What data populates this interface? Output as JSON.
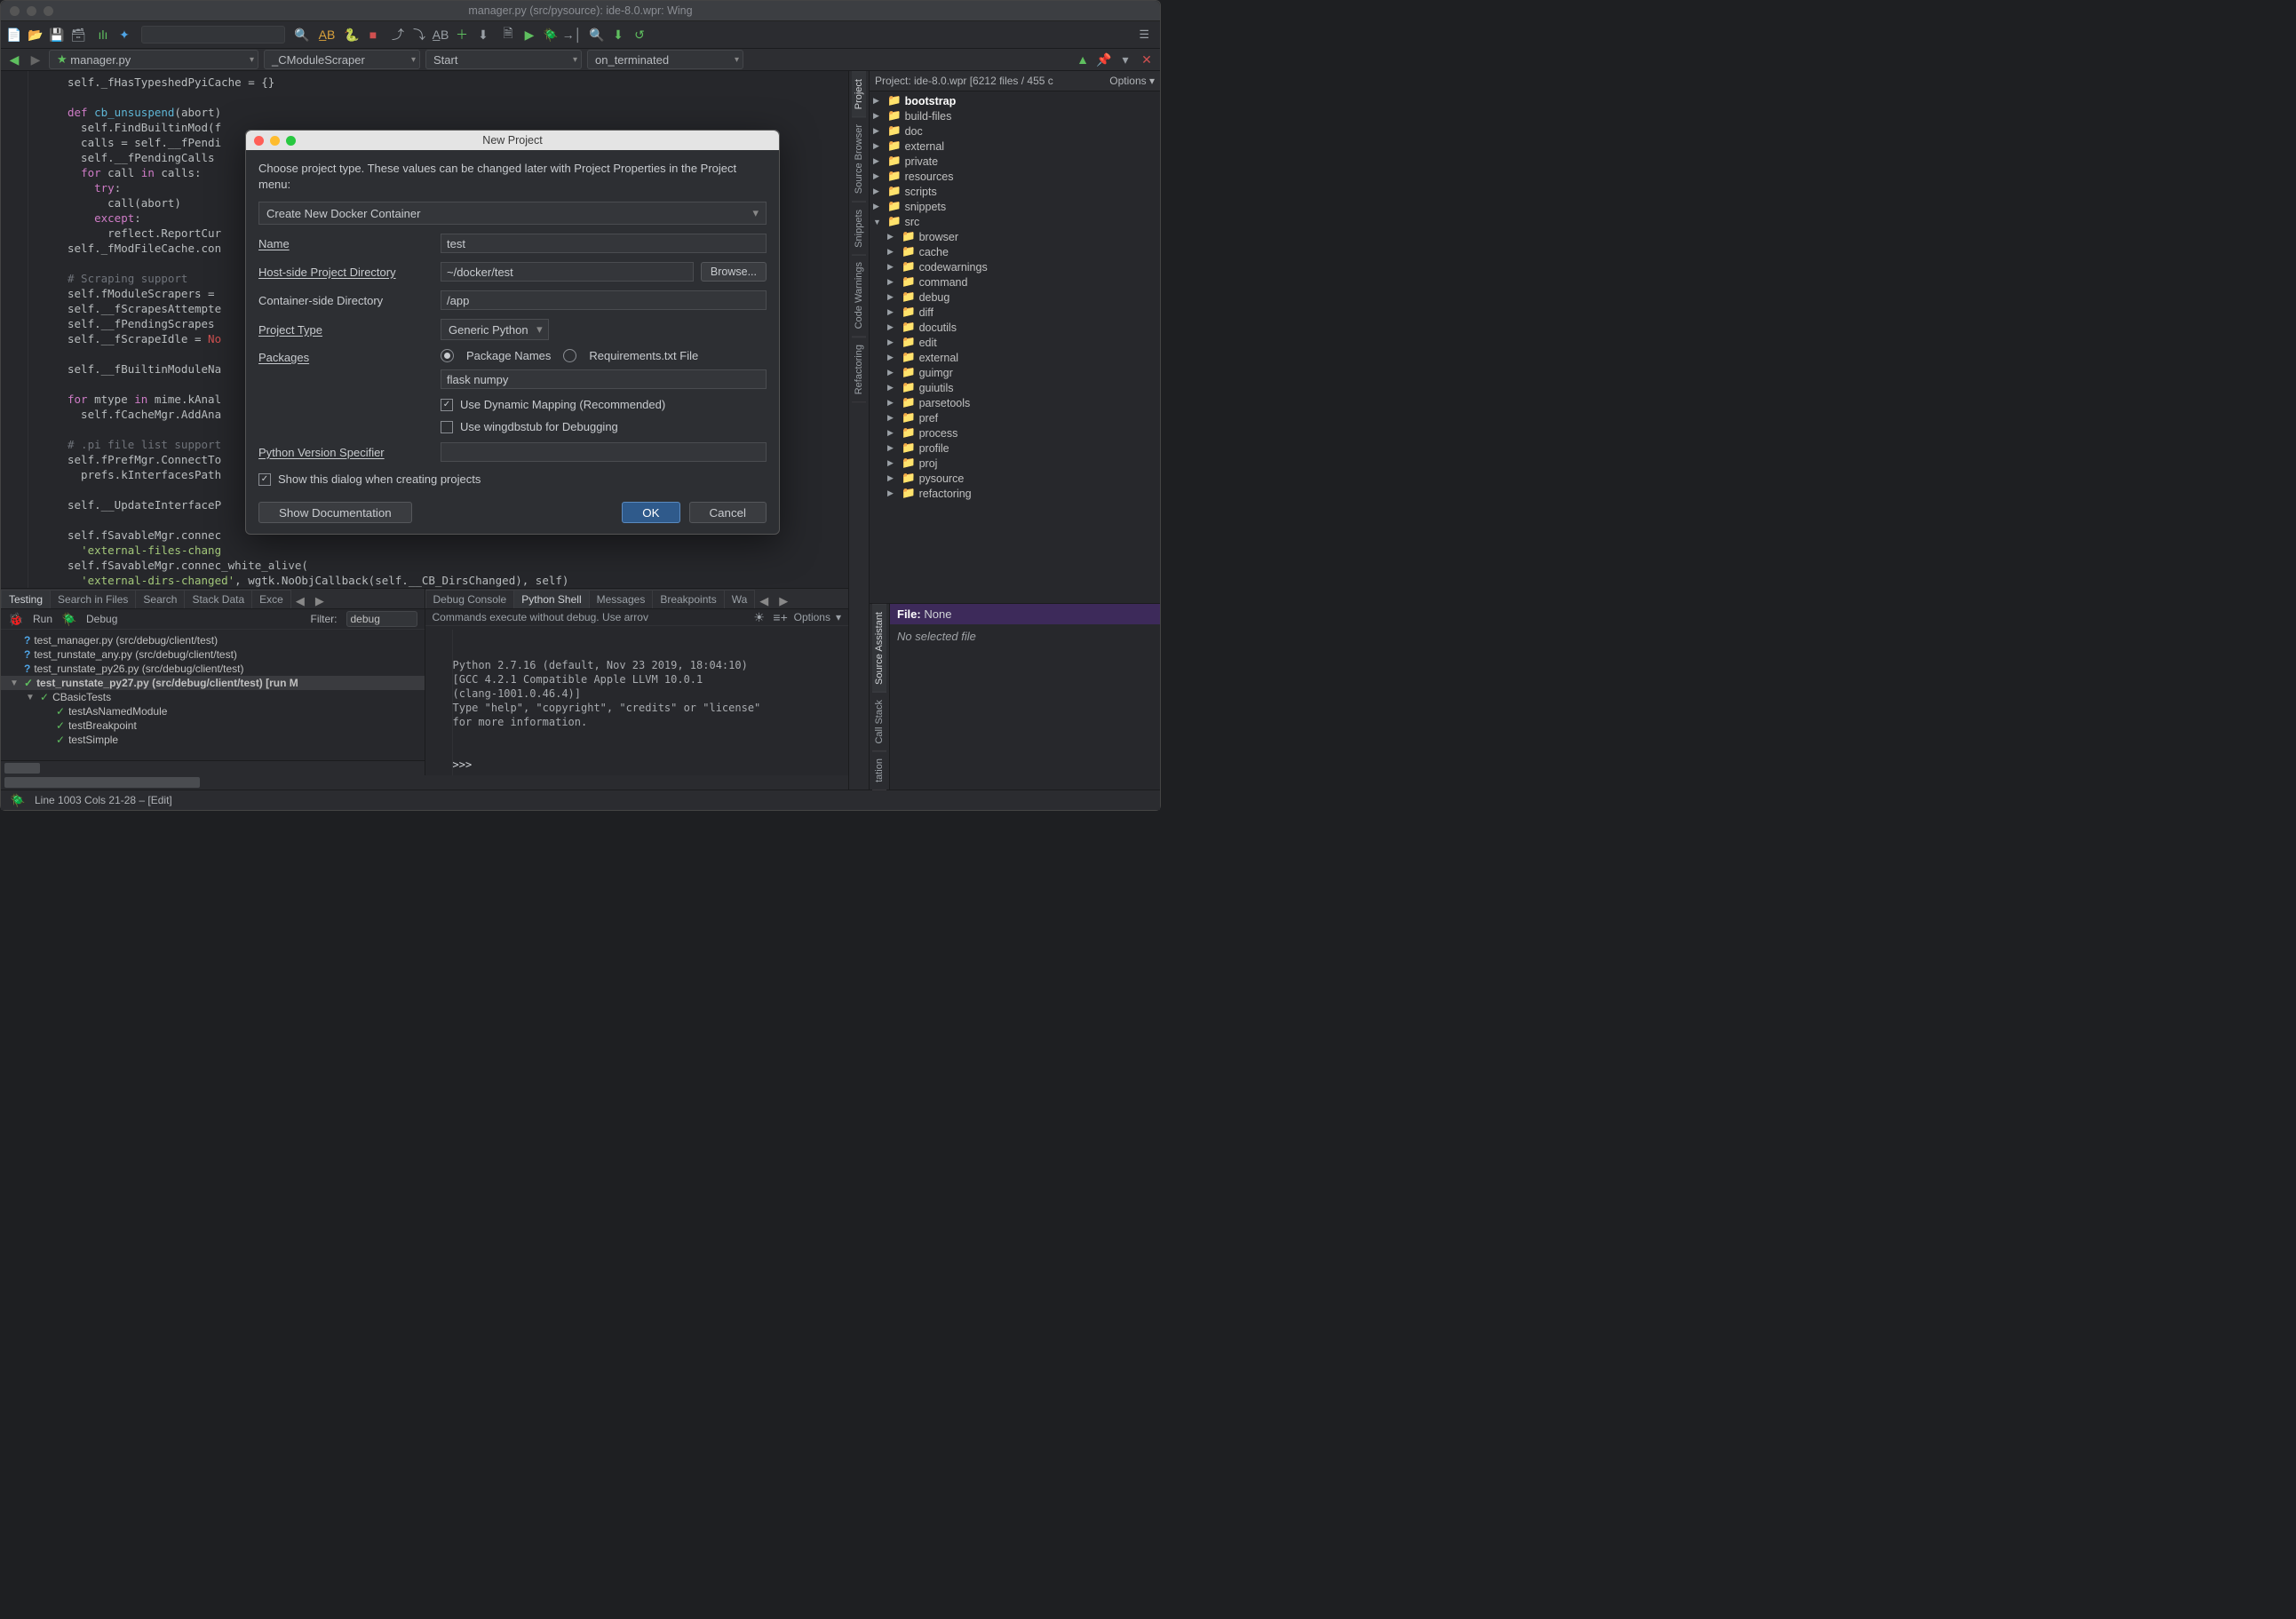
{
  "window_title": "manager.py (src/pysource): ide-8.0.wpr: Wing",
  "nav": {
    "file": "manager.py",
    "class": "_CModuleScraper",
    "method": "Start",
    "callback": "on_terminated"
  },
  "code_lines": [
    "self._fHasTypeshedPyiCache = {}",
    "",
    "<kw>def</kw> <fn>cb_unsuspend</fn>(abort)",
    "  self.FindBuiltinMod(f",
    "  calls = self.__fPendi",
    "  self.__fPendingCalls",
    "  <kw>for</kw> call <kw>in</kw> calls:",
    "    <kw>try</kw>:",
    "      call(abort)",
    "    <kw>except</kw>:",
    "      reflect.ReportCur",
    "self._fModFileCache.con",
    "",
    "<cmt># Scraping support</cmt>",
    "self.fModuleScrapers =",
    "self.__fScrapesAttempte",
    "self.__fPendingScrapes",
    "self.__fScrapeIdle = <err>No</err>",
    "",
    "self.__fBuiltinModuleNa",
    "",
    "<kw>for</kw> mtype <kw>in</kw> mime.kAnal",
    "  self.fCacheMgr.AddAna",
    "",
    "<cmt># .pi file list support</cmt>",
    "self.fPrefMgr.ConnectTo",
    "  prefs.kInterfacesPath",
    "",
    "self.__UpdateInterfaceP",
    "",
    "self.fSavableMgr.connec",
    "  <str>'external-files-chang</str>",
    "self.fSavableMgr.connec_white_alive(",
    "  <str>'external-dirs-changed'</str>, wgtk.NoObjCallback(self.__CB_DirsChanged), self)"
  ],
  "bottom_left_tabs": [
    "Testing",
    "Search in Files",
    "Search",
    "Stack Data",
    "Exce"
  ],
  "test_toolbar": {
    "run": "Run",
    "debug": "Debug",
    "filter_label": "Filter:",
    "filter_value": "debug"
  },
  "tests": [
    {
      "icon": "?",
      "name": "test_manager.py (src/debug/client/test)",
      "ind": 0
    },
    {
      "icon": "?",
      "name": "test_runstate_any.py (src/debug/client/test)",
      "ind": 0
    },
    {
      "icon": "?",
      "name": "test_runstate_py26.py (src/debug/client/test)",
      "ind": 0
    },
    {
      "icon": "✓",
      "name": "test_runstate_py27.py (src/debug/client/test) [run M",
      "ind": 0,
      "tw": "▼",
      "run": true
    },
    {
      "icon": "✓",
      "name": "CBasicTests",
      "ind": 1,
      "tw": "▼"
    },
    {
      "icon": "✓",
      "name": "testAsNamedModule",
      "ind": 2
    },
    {
      "icon": "✓",
      "name": "testBreakpoint",
      "ind": 2
    },
    {
      "icon": "✓",
      "name": "testSimple",
      "ind": 2
    }
  ],
  "bottom_right_tabs": [
    "Debug Console",
    "Python Shell",
    "Messages",
    "Breakpoints",
    "Wa"
  ],
  "shell_head": "Commands execute without debug.  Use arrov",
  "shell_options": "Options",
  "shell_text": "Python 2.7.16 (default, Nov 23 2019, 18:04:10)\n[GCC 4.2.1 Compatible Apple LLVM 10.0.1\n(clang-1001.0.46.4)]\nType \"help\", \"copyright\", \"credits\" or \"license\"\nfor more information.",
  "shell_prompt": ">>>",
  "project_header": "Project: ide-8.0.wpr [6212 files / 455 c",
  "project_options": "Options",
  "project_tree": [
    {
      "ind": 0,
      "tw": "▶",
      "name": "bootstrap",
      "bold": true
    },
    {
      "ind": 0,
      "tw": "▶",
      "name": "build-files"
    },
    {
      "ind": 0,
      "tw": "▶",
      "name": "doc"
    },
    {
      "ind": 0,
      "tw": "▶",
      "name": "external"
    },
    {
      "ind": 0,
      "tw": "▶",
      "name": "private"
    },
    {
      "ind": 0,
      "tw": "▶",
      "name": "resources"
    },
    {
      "ind": 0,
      "tw": "▶",
      "name": "scripts"
    },
    {
      "ind": 0,
      "tw": "▶",
      "name": "snippets"
    },
    {
      "ind": 0,
      "tw": "▼",
      "name": "src"
    },
    {
      "ind": 1,
      "tw": "▶",
      "name": "browser"
    },
    {
      "ind": 1,
      "tw": "▶",
      "name": "cache"
    },
    {
      "ind": 1,
      "tw": "▶",
      "name": "codewarnings"
    },
    {
      "ind": 1,
      "tw": "▶",
      "name": "command"
    },
    {
      "ind": 1,
      "tw": "▶",
      "name": "debug"
    },
    {
      "ind": 1,
      "tw": "▶",
      "name": "diff"
    },
    {
      "ind": 1,
      "tw": "▶",
      "name": "docutils"
    },
    {
      "ind": 1,
      "tw": "▶",
      "name": "edit"
    },
    {
      "ind": 1,
      "tw": "▶",
      "name": "external"
    },
    {
      "ind": 1,
      "tw": "▶",
      "name": "guimgr"
    },
    {
      "ind": 1,
      "tw": "▶",
      "name": "guiutils"
    },
    {
      "ind": 1,
      "tw": "▶",
      "name": "parsetools"
    },
    {
      "ind": 1,
      "tw": "▶",
      "name": "pref"
    },
    {
      "ind": 1,
      "tw": "▶",
      "name": "process"
    },
    {
      "ind": 1,
      "tw": "▶",
      "name": "profile"
    },
    {
      "ind": 1,
      "tw": "▶",
      "name": "proj"
    },
    {
      "ind": 1,
      "tw": "▶",
      "name": "pysource"
    },
    {
      "ind": 1,
      "tw": "▶",
      "name": "refactoring"
    }
  ],
  "vtabs_top": [
    "Project",
    "Source Browser",
    "Snippets",
    "Code Warnings",
    "Refactoring"
  ],
  "vtabs_bottom": [
    "Source Assistant",
    "Call Stack",
    "tation"
  ],
  "source_assistant": {
    "file_label": "File:",
    "file_value": "None",
    "msg": "No selected file"
  },
  "status": "Line 1003 Cols 21-28 – [Edit]",
  "dialog": {
    "title": "New Project",
    "intro": "Choose project type.  These values can be changed later with Project Properties in the Project menu:",
    "combo": "Create New Docker Container",
    "name_label": "Name",
    "name_value": "test",
    "hostdir_label": "Host-side Project Directory",
    "hostdir_value": "~/docker/test",
    "browse": "Browse...",
    "cdir_label": "Container-side Directory",
    "cdir_value": "/app",
    "ptype_label": "Project Type",
    "ptype_value": "Generic Python",
    "packages_label": "Packages",
    "radio1": "Package Names",
    "radio2": "Requirements.txt File",
    "packages_value": "flask numpy",
    "dyn_map": "Use Dynamic Mapping (Recommended)",
    "wingdb": "Use wingdbstub for Debugging",
    "pyver_label": "Python Version Specifier",
    "pyver_value": "",
    "show_dlg": "Show this dialog when creating projects",
    "show_doc": "Show Documentation",
    "ok": "OK",
    "cancel": "Cancel"
  }
}
